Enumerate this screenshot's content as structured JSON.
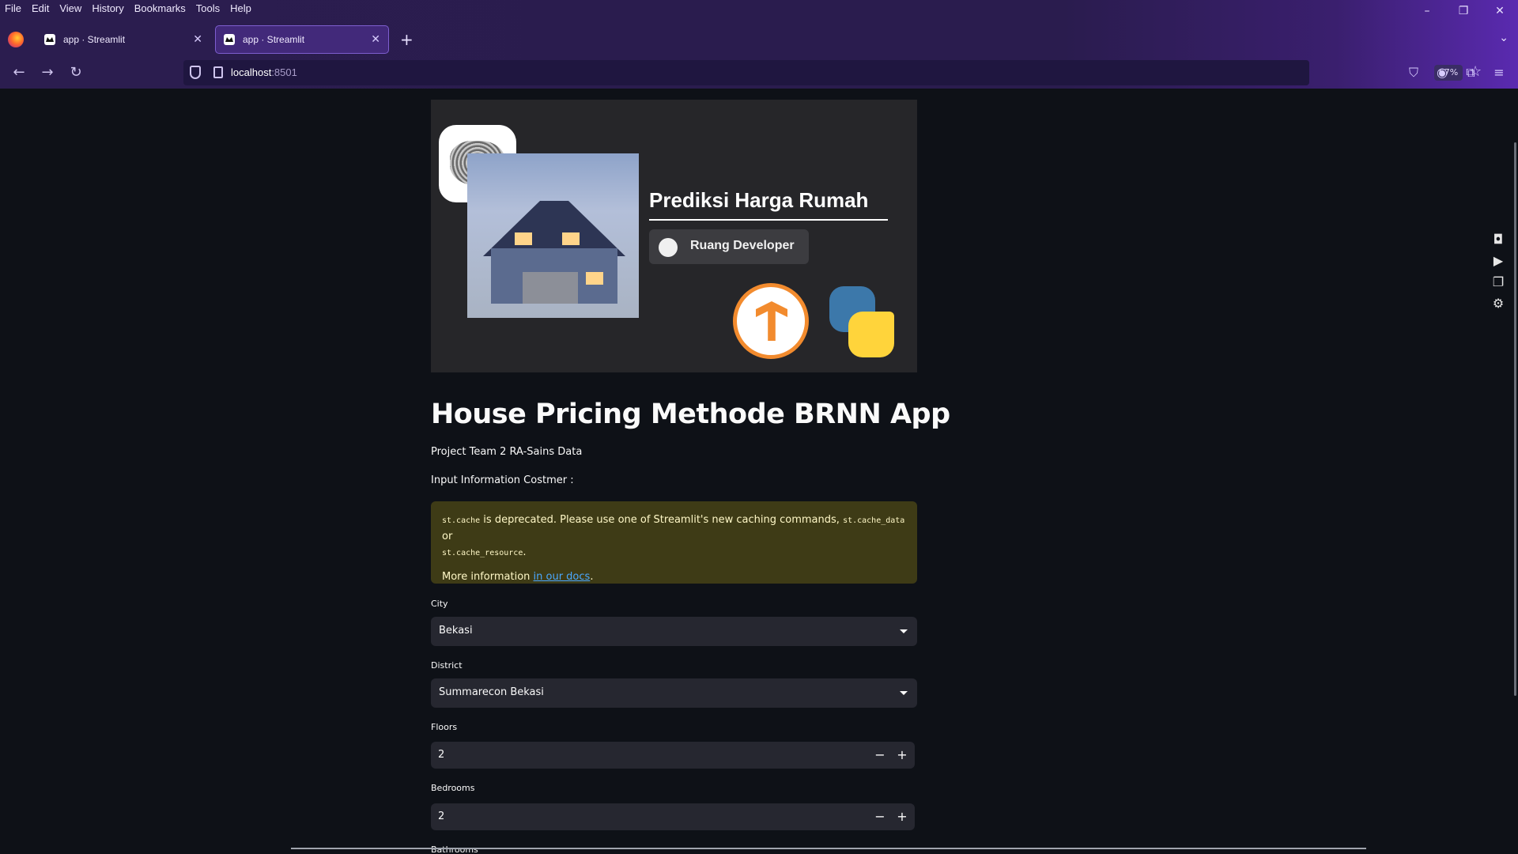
{
  "browser": {
    "menu": [
      "File",
      "Edit",
      "View",
      "History",
      "Bookmarks",
      "Tools",
      "Help"
    ],
    "tabs": [
      {
        "title": "app · Streamlit",
        "active": false
      },
      {
        "title": "app · Streamlit",
        "active": true
      }
    ],
    "url_host": "localhost",
    "url_port": ":8501",
    "zoom": "67%",
    "accent": "#2b1d4f"
  },
  "banner": {
    "title": "Prediksi Harga Rumah",
    "chip": "Ruang Developer"
  },
  "page": {
    "title": "House Pricing Methode BRNN App",
    "subtitle": "Project Team 2 RA-Sains Data",
    "section": "Input Information Costmer :"
  },
  "warning": {
    "code1": "st.cache",
    "text1": " is deprecated. Please use one of Streamlit's new caching commands, ",
    "code2": "st.cache_data",
    "text2": " or ",
    "code3": "st.cache_resource",
    "text3": ".",
    "more": "More information ",
    "link": "in our docs",
    "end": "."
  },
  "form": {
    "city_label": "City",
    "city_value": "Bekasi",
    "district_label": "District",
    "district_value": "Summarecon Bekasi",
    "floors_label": "Floors",
    "floors_value": "2",
    "bedrooms_label": "Bedrooms",
    "bedrooms_value": "2",
    "bathrooms_label": "Bathrooms",
    "minus": "−",
    "plus": "+"
  }
}
